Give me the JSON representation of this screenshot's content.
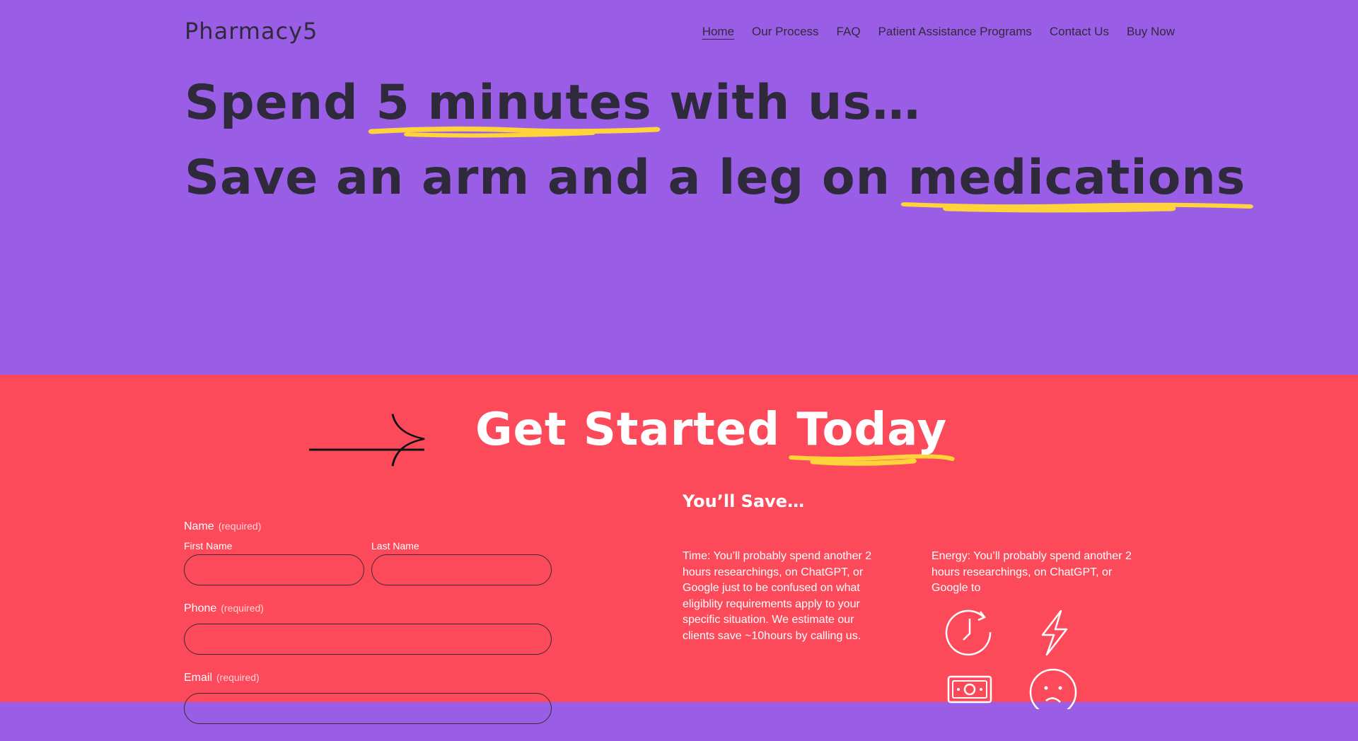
{
  "brand": "Pharmacy5",
  "nav": {
    "items": [
      {
        "label": "Home",
        "active": true
      },
      {
        "label": "Our Process"
      },
      {
        "label": "FAQ"
      },
      {
        "label": "Patient Assistance Programs"
      },
      {
        "label": "Contact Us"
      },
      {
        "label": "Buy Now"
      }
    ]
  },
  "hero": {
    "line1_before": "Spend ",
    "line1_highlight": "5 minutes",
    "line1_after": " with us…",
    "line2_before": "Save an arm and a leg on ",
    "line2_highlight": "medications"
  },
  "cta": {
    "title_before": "Get Started ",
    "title_highlight": "Today"
  },
  "form": {
    "name_label": "Name",
    "name_required": "(required)",
    "first_name_label": "First Name",
    "last_name_label": "Last Name",
    "phone_label": "Phone",
    "phone_required": "(required)",
    "email_label": "Email",
    "email_required": "(required)"
  },
  "savings": {
    "title": "You’ll Save…",
    "time_text": "Time: You’ll probably spend another 2 hours researchings, on ChatGPT, or Google just to be confused on what eligiblity requirements apply to your specific situation. We estimate our clients save ~10hours by calling us.",
    "energy_text": "Energy: You’ll probably spend another 2 hours researchings, on ChatGPT, or Google to"
  },
  "colors": {
    "hero_bg": "#9a5de6",
    "cta_bg": "#fd4a5a",
    "highlight": "#ffd43b",
    "text_dark": "#2f2a3b"
  },
  "icons": [
    "arrow-right-icon",
    "clock-icon",
    "lightning-icon",
    "money-icon",
    "face-icon"
  ]
}
